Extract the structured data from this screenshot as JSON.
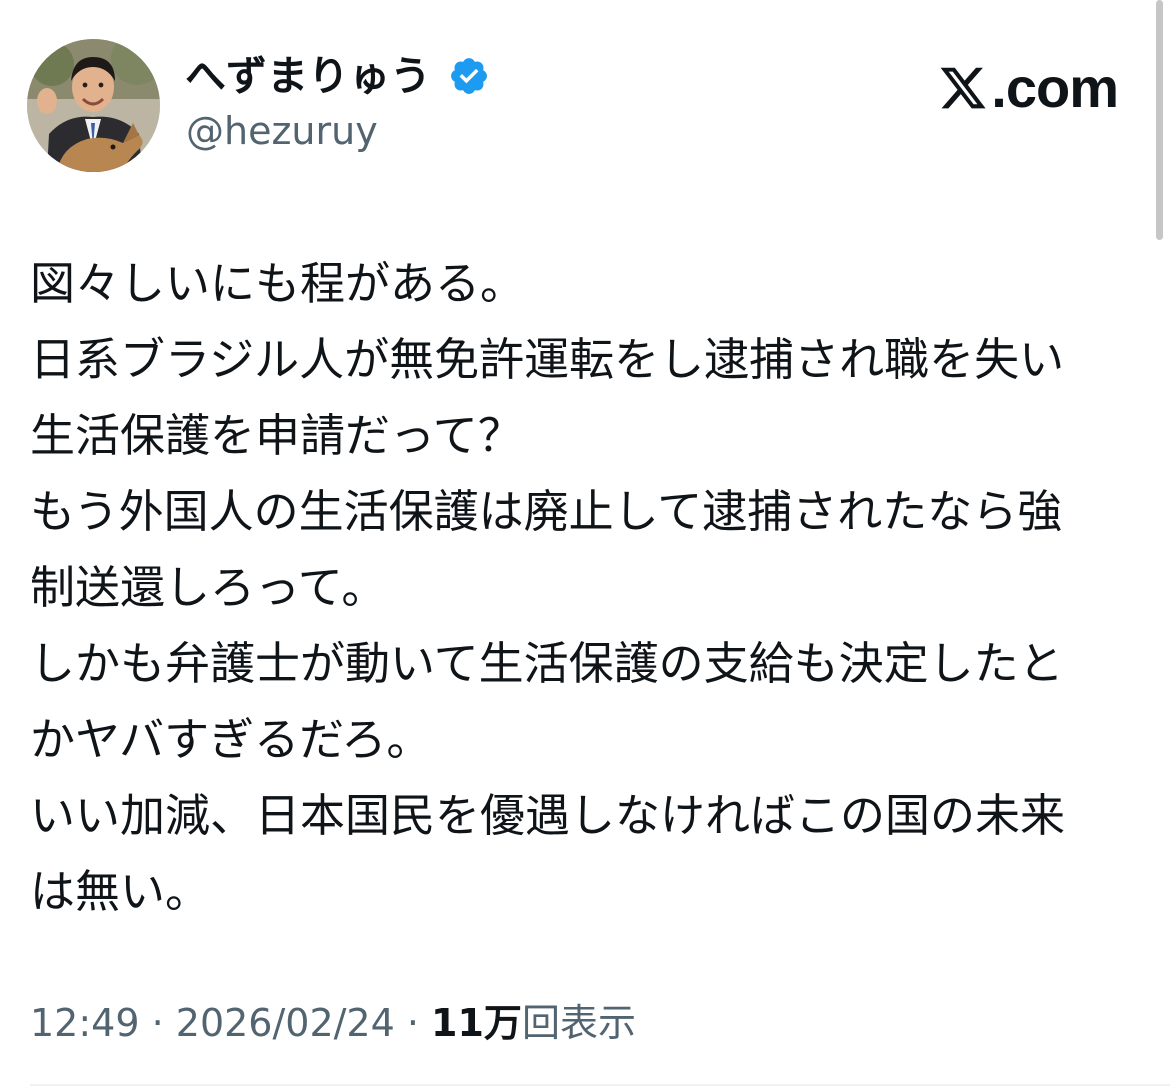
{
  "header": {
    "display_name": "へずまりゅう",
    "handle": "@hezuruy",
    "brand_label": ".com",
    "brand_icon": "x-logo-icon",
    "verified_icon": "verified-badge-icon",
    "verified_color": "#1d9bf0"
  },
  "tweet": {
    "lines": [
      "図々しいにも程がある。",
      "日系ブラジル人が無免許運転をし逮捕され職を失い",
      "生活保護を申請だって？",
      "もう外国人の生活保護は廃止して逮捕されたなら強",
      "制送還しろって。",
      "しかも弁護士が動いて生活保護の支給も決定したと",
      "かヤバすぎるだろ。",
      "いい加減、日本国民を優遇しなければこの国の未来",
      "は無い。"
    ]
  },
  "meta": {
    "time": "12:49",
    "separator": " · ",
    "date": "2026/02/24",
    "views_count": "11万",
    "views_label": "回表示"
  },
  "colors": {
    "text_primary": "#0f1419",
    "text_secondary": "#536471",
    "accent": "#1d9bf0"
  }
}
